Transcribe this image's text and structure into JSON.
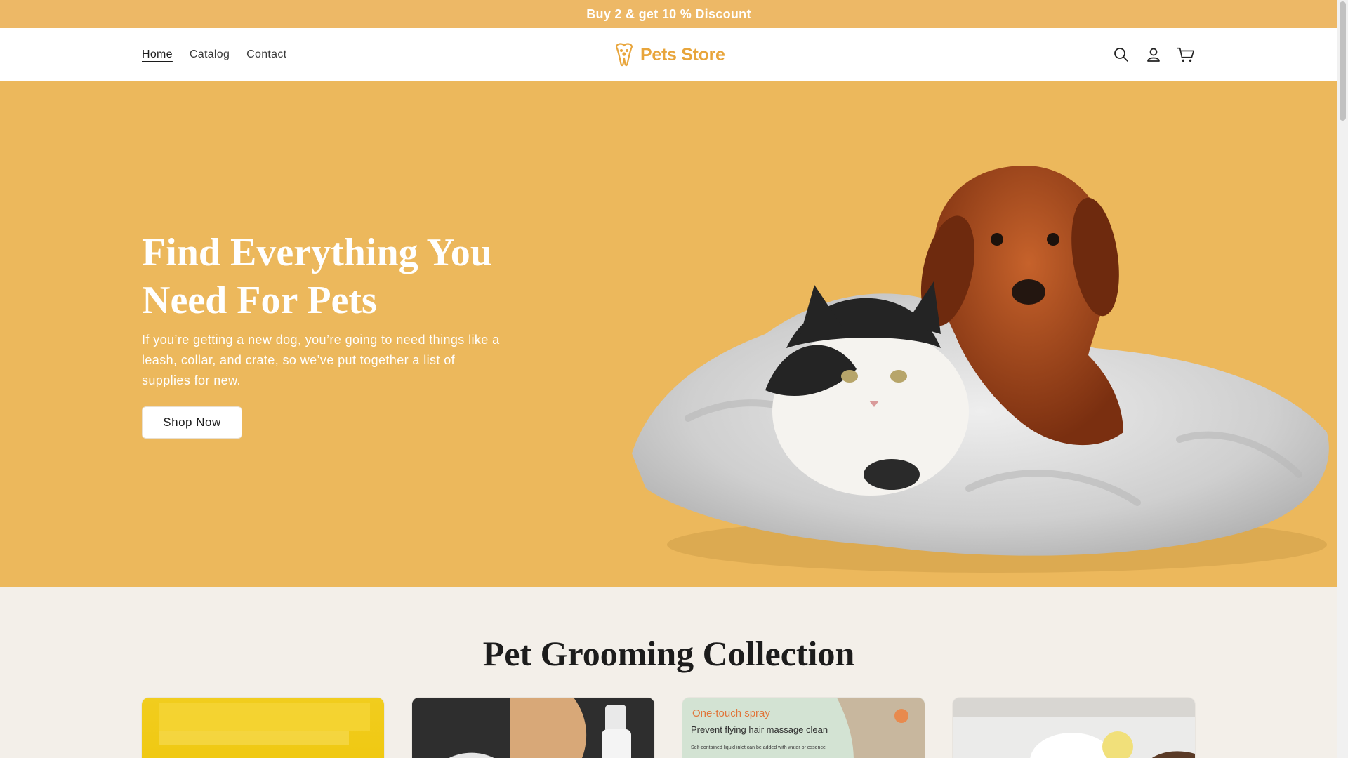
{
  "announcement": {
    "text": "Buy 2 & get 10 % Discount"
  },
  "header": {
    "nav": [
      {
        "label": "Home",
        "active": true
      },
      {
        "label": "Catalog",
        "active": false
      },
      {
        "label": "Contact",
        "active": false
      }
    ],
    "logo_text": "Pets Store",
    "icons": [
      "search-icon",
      "account-icon",
      "cart-icon"
    ]
  },
  "hero": {
    "title": "Find Everything You Need For Pets",
    "text": "If you’re getting a new dog, you’re going to need things like a leash, collar, and crate, so we’ve put together a list of supplies for new.",
    "button_label": "Shop Now"
  },
  "collection": {
    "title": "Pet Grooming Collection",
    "card3": {
      "spray_label": "One-touch spray",
      "prevent_label": "Prevent flying hair massage clean",
      "small_label": "Self-contained liquid inlet can be added with water or essence"
    }
  },
  "colors": {
    "announcement_bg": "#edb866",
    "hero_bg": "#ecb85c",
    "brand": "#e8a53b",
    "page_bg": "#f3efe9"
  }
}
